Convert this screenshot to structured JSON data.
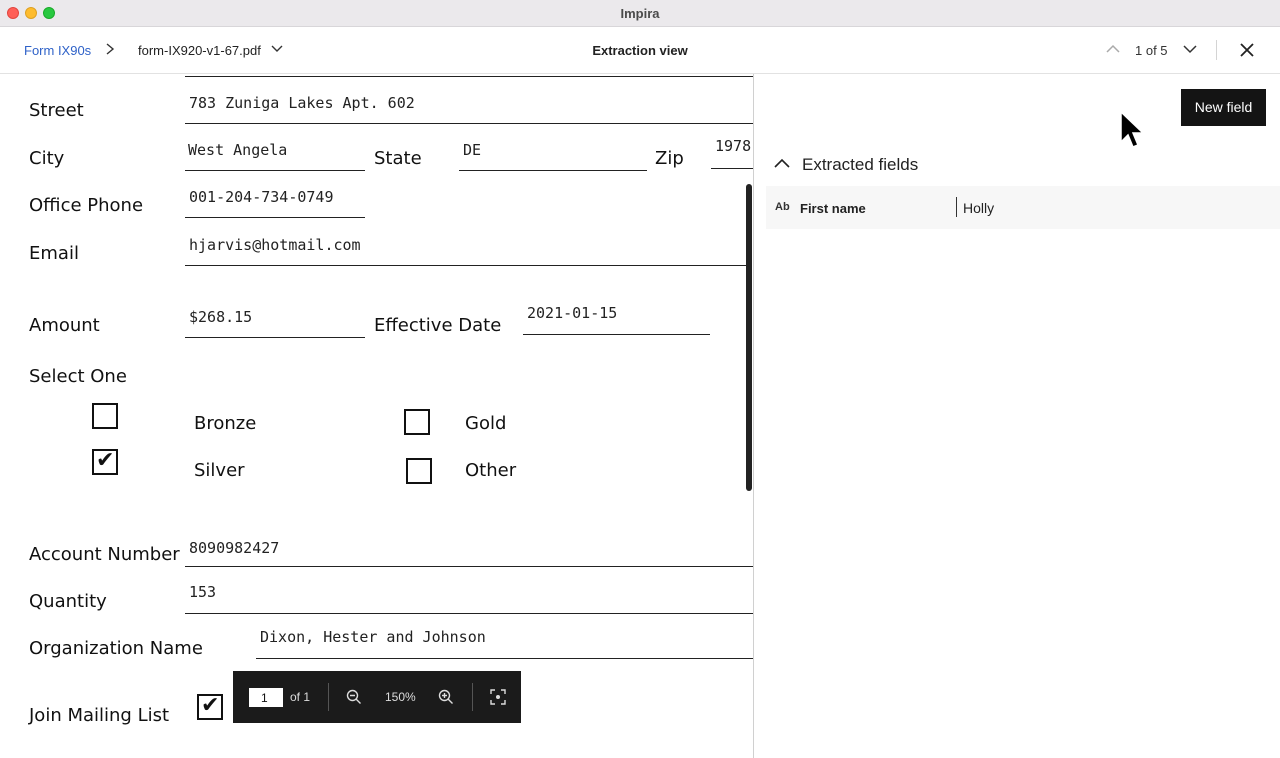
{
  "window": {
    "title": "Impira"
  },
  "header": {
    "breadcrumb_root": "Form IX90s",
    "file_name": "form-IX920-v1-67.pdf",
    "view_title": "Extraction view",
    "nav_count": "1 of 5"
  },
  "document": {
    "street_label": "Street",
    "street_value": "783 Zuniga Lakes Apt. 602",
    "city_label": "City",
    "city_value": "West Angela",
    "state_label": "State",
    "state_value": "DE",
    "zip_label": "Zip",
    "zip_value": "1978",
    "phone_label": "Office Phone",
    "phone_value": "001-204-734-0749",
    "email_label": "Email",
    "email_value": "hjarvis@hotmail.com",
    "amount_label": "Amount",
    "amount_value": "$268.15",
    "date_label": "Effective Date",
    "date_value": "2021-01-15",
    "select_label": "Select One",
    "options": [
      {
        "label": "Bronze",
        "checked": false
      },
      {
        "label": "Gold",
        "checked": false
      },
      {
        "label": "Silver",
        "checked": true
      },
      {
        "label": "Other",
        "checked": false
      }
    ],
    "account_label": "Account Number",
    "account_value": "8090982427",
    "quantity_label": "Quantity",
    "quantity_value": "153",
    "org_label": "Organization Name",
    "org_value": "Dixon, Hester and Johnson",
    "mailing_label": "Join Mailing List",
    "mailing_checked": true,
    "check_glyph": "✔"
  },
  "pager": {
    "page_value": "1",
    "page_of": "of 1",
    "zoom": "150%"
  },
  "panel": {
    "new_field_label": "New field",
    "section_title": "Extracted fields",
    "fields": [
      {
        "type_badge": "Ab",
        "name": "First name",
        "value": "Holly"
      }
    ]
  }
}
